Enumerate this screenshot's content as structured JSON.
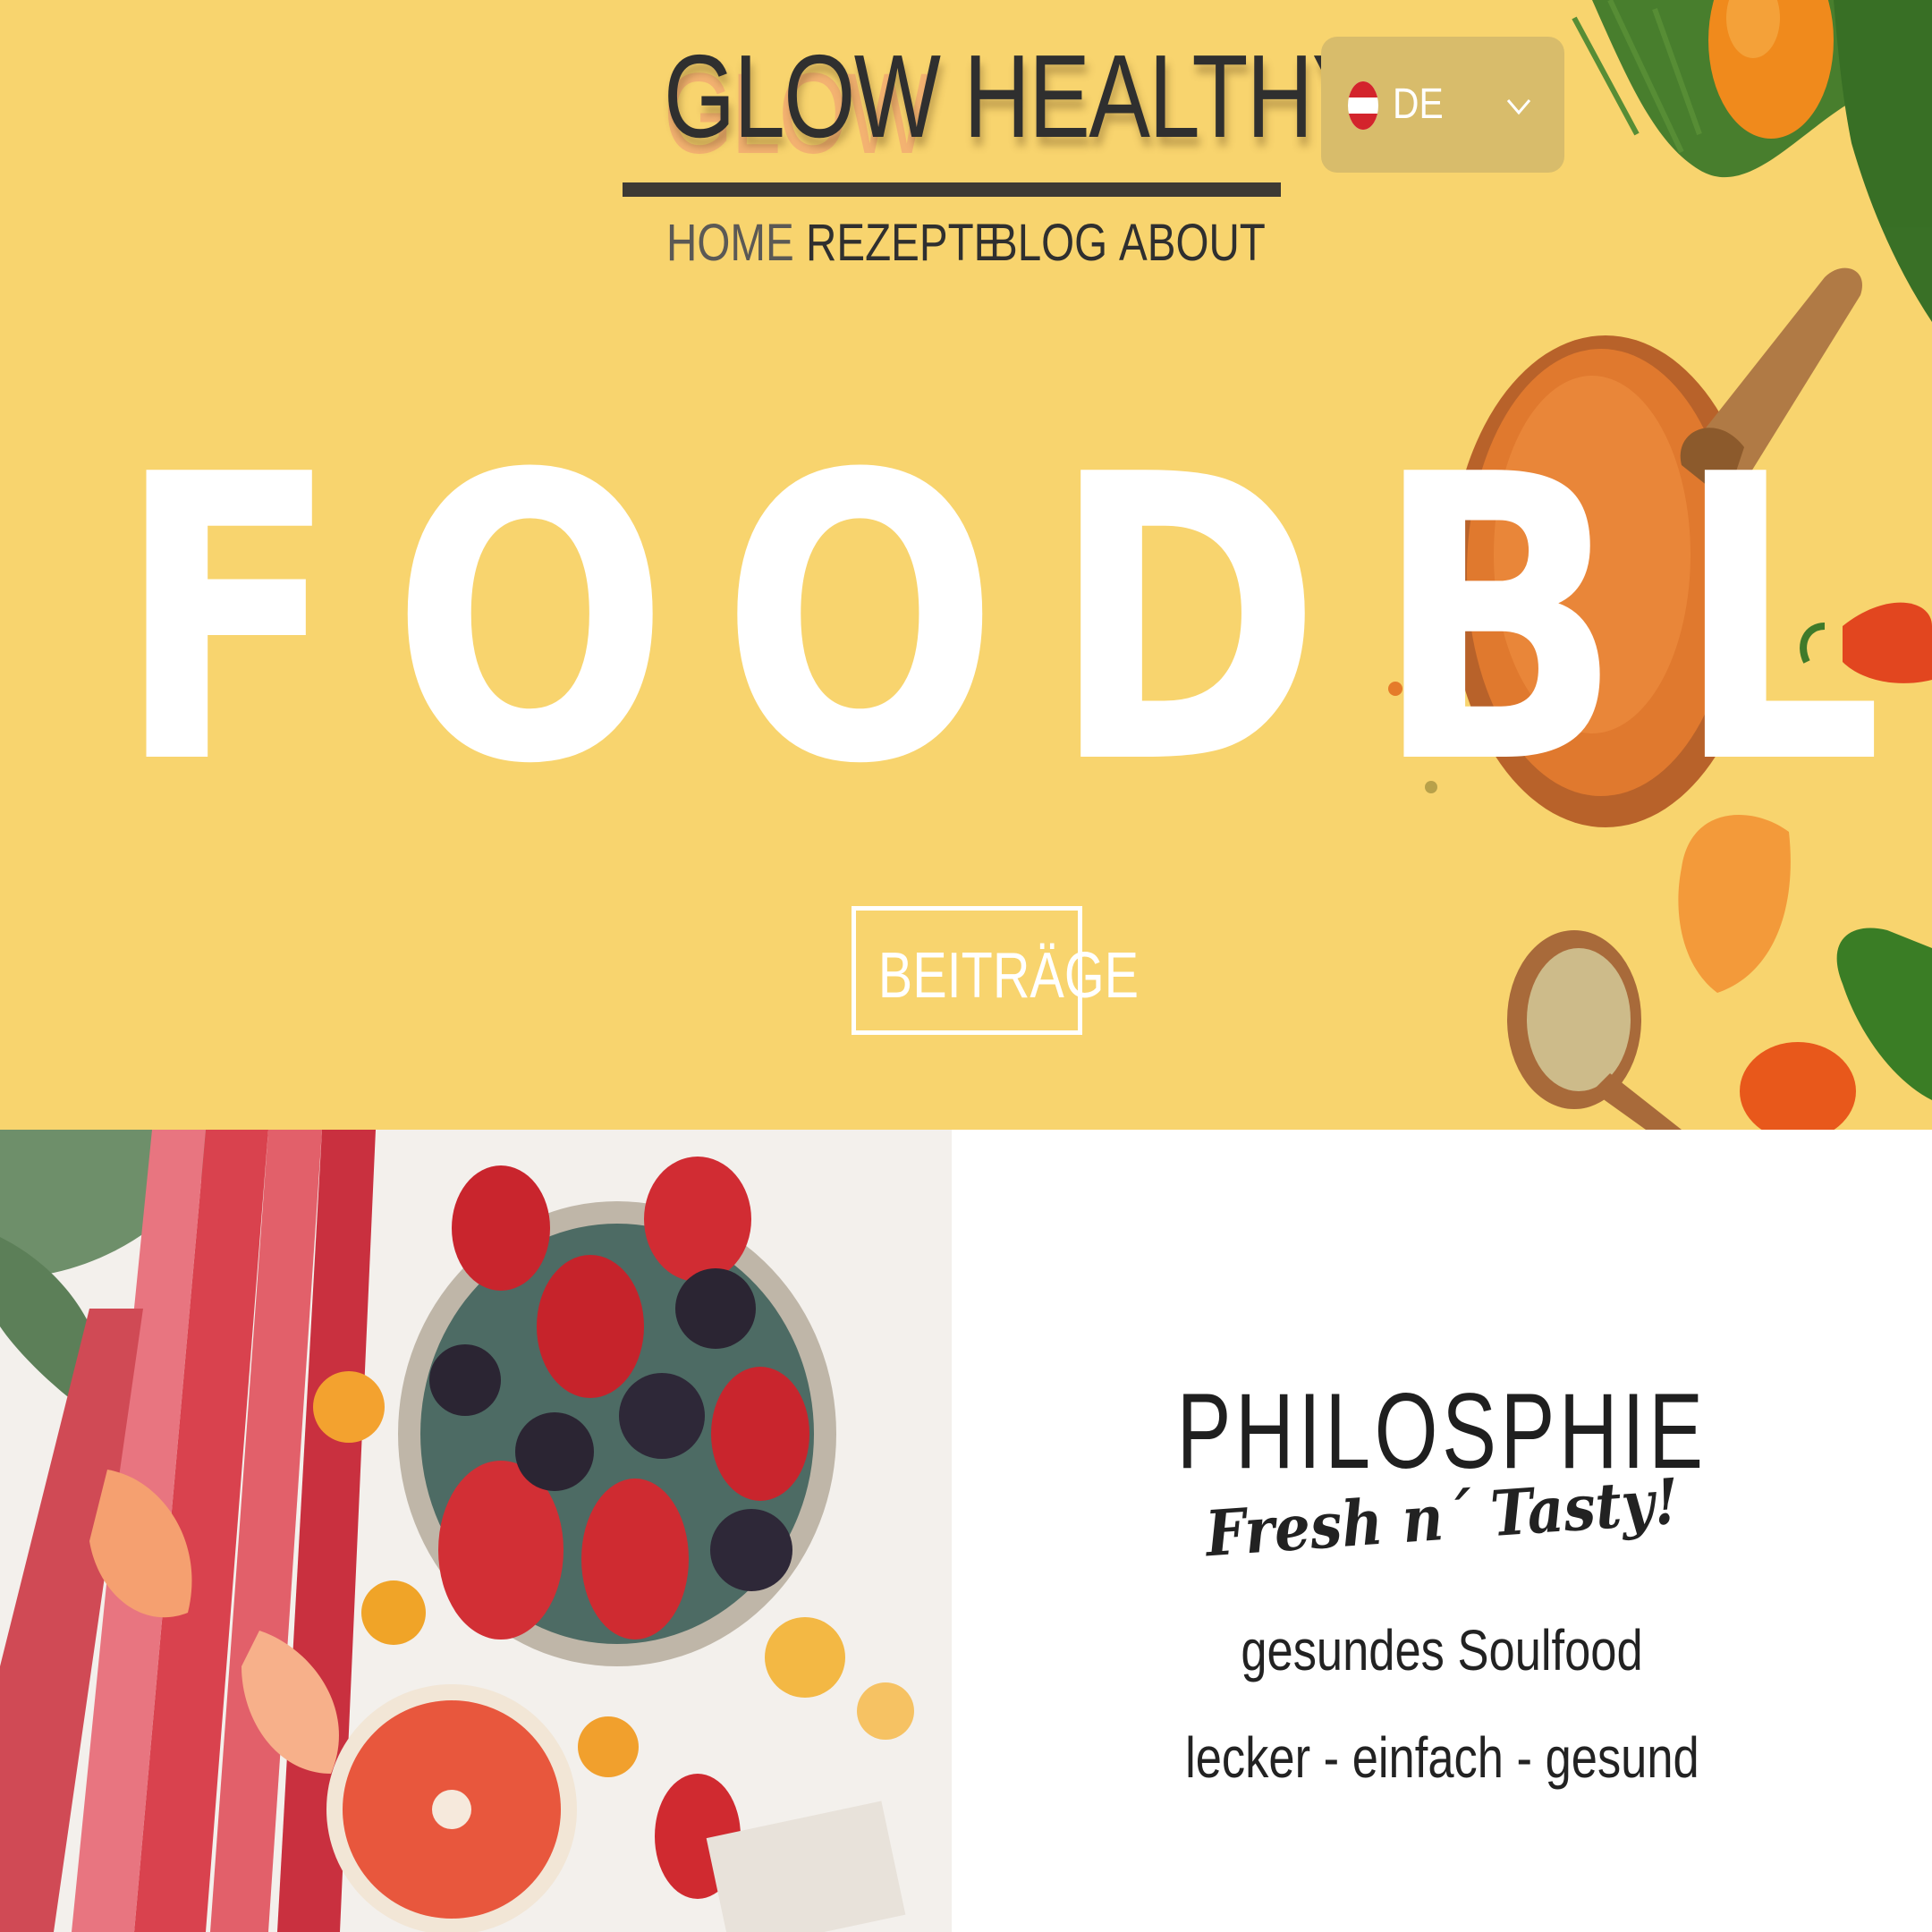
{
  "header": {
    "logo_text": "GLOW HEALTHY",
    "logo_shadow_text": "GLOW"
  },
  "nav": {
    "items": [
      {
        "label": "HOME",
        "active": true
      },
      {
        "label": "REZEPTE",
        "active": false
      },
      {
        "label": "BLOG",
        "active": false
      },
      {
        "label": "ABOUT",
        "active": false
      }
    ]
  },
  "language_selector": {
    "current": "DE",
    "flag": "austria-flag-icon",
    "chevron": "chevron-down-icon"
  },
  "hero": {
    "headline": "FOODBLOG",
    "button_label": "BEITRÄGE",
    "background_color": "#f8d46e"
  },
  "philosophy": {
    "title": "PHILOSPHIE",
    "tagline": "Fresh n´ Tasty!",
    "line1": "gesundes Soulfood",
    "line2": "lecker - einfach - gesund"
  },
  "colors": {
    "text_dark": "#2f2f2f",
    "lang_bg": "#d8bc6b",
    "accent_red": "#d3242c"
  }
}
